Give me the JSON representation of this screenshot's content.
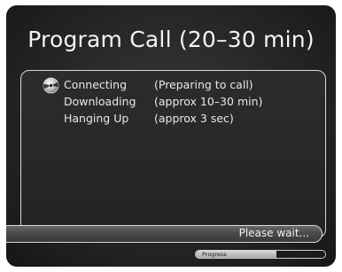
{
  "dialog": {
    "title": "Program Call (20–30 min)"
  },
  "steps": [
    {
      "name": "Connecting",
      "detail": "(Preparing to call)",
      "icon": "disc-icon"
    },
    {
      "name": "Downloading",
      "detail": "(approx 10–30 min)"
    },
    {
      "name": "Hanging Up",
      "detail": "(approx 3 sec)"
    }
  ],
  "status": {
    "message": "Please wait..."
  },
  "progress": {
    "label": "Progress",
    "fraction": 0.62
  },
  "colors": {
    "background": "#262626",
    "text": "#f4f4f4",
    "border": "#d8d8d8"
  }
}
